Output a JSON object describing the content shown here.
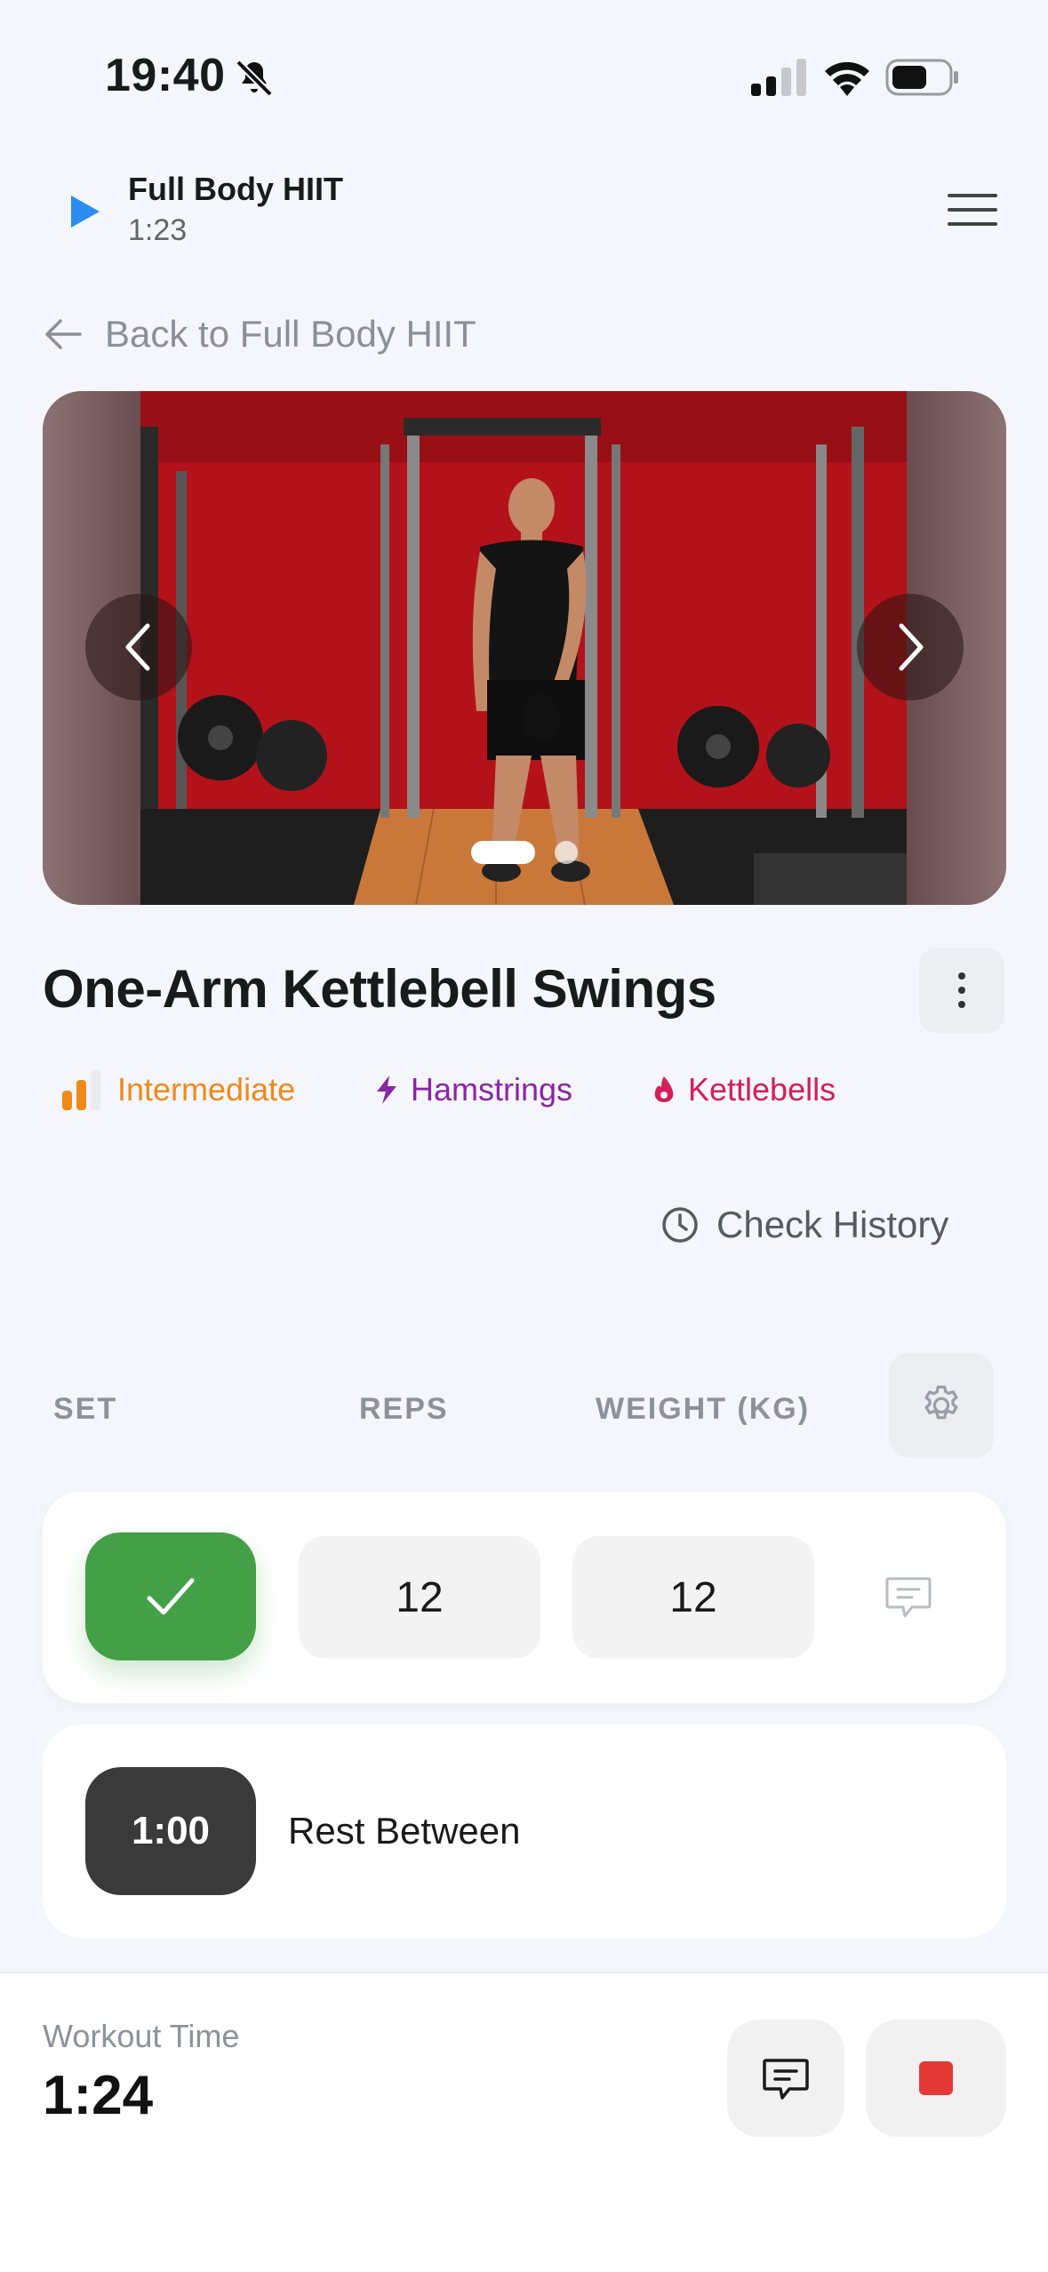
{
  "status_bar": {
    "time": "19:40"
  },
  "header": {
    "workout_title": "Full Body HIIT",
    "workout_timer": "1:23"
  },
  "back_link": {
    "label": "Back to Full Body HIIT"
  },
  "carousel": {
    "total_slides": 2,
    "active_slide": 1
  },
  "exercise": {
    "title": "One-Arm Kettlebell Swings",
    "tags": {
      "level": "Intermediate",
      "muscle": "Hamstrings",
      "equipment": "Kettlebells"
    },
    "check_history_label": "Check History"
  },
  "table": {
    "headers": {
      "set": "SET",
      "reps": "REPS",
      "weight": "WEIGHT (KG)"
    },
    "rows": [
      {
        "reps": "12",
        "weight": "12",
        "completed": true
      }
    ],
    "rest": {
      "time": "1:00",
      "label": "Rest Between"
    }
  },
  "footer": {
    "workout_time_label": "Workout Time",
    "workout_time_value": "1:24"
  },
  "colors": {
    "accent_play": "#2b8cf0",
    "check_green": "#43a047",
    "level_orange": "#ef8a1a",
    "muscle_purple": "#8a25a6",
    "equipment_pink": "#d41e57",
    "stop_red": "#e53935"
  },
  "icons": {
    "status": [
      "bell-off-icon",
      "signal-icon",
      "wifi-icon",
      "battery-icon"
    ],
    "header": [
      "play-icon",
      "menu-icon"
    ],
    "misc": [
      "arrow-left-icon",
      "chevron-left-icon",
      "chevron-right-icon",
      "more-vertical-icon",
      "level-bars-icon",
      "bolt-icon",
      "flame-icon",
      "clock-icon",
      "gear-icon",
      "check-icon",
      "comment-icon",
      "stop-icon"
    ]
  }
}
